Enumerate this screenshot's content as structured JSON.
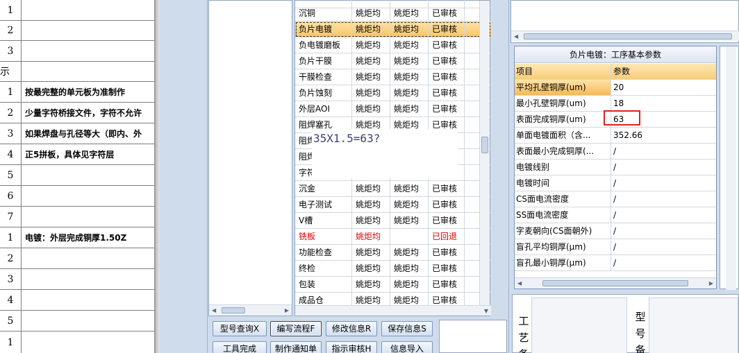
{
  "sheet": {
    "rows": [
      {
        "no": "1",
        "text": ""
      },
      {
        "no": "2",
        "text": ""
      },
      {
        "no": "3",
        "text": ""
      },
      {
        "no": "示",
        "text": ""
      },
      {
        "no": "1",
        "text": "按最完整的单元板为准制作"
      },
      {
        "no": "2",
        "text": "少量字符桥接文件，字符不允许"
      },
      {
        "no": "3",
        "text": "如果焊盘与孔径等大（即内、外"
      },
      {
        "no": "4",
        "text": "正5拼板，具体见字符层"
      },
      {
        "no": "5",
        "text": ""
      },
      {
        "no": "6",
        "text": ""
      },
      {
        "no": "7",
        "text": ""
      },
      {
        "no": "1",
        "text": "电镀：外层完成铜厚1.50Z"
      },
      {
        "no": "2",
        "text": ""
      },
      {
        "no": "3",
        "text": ""
      },
      {
        "no": "4",
        "text": ""
      },
      {
        "no": "5",
        "text": ""
      },
      {
        "no": "1",
        "text": ""
      }
    ]
  },
  "process": {
    "rows": [
      {
        "step": "",
        "a": "",
        "b": "",
        "status": ""
      },
      {
        "step": "沉铜",
        "a": "姚炬均",
        "b": "姚炬均",
        "status": "已审核"
      },
      {
        "step": "负片电镀",
        "a": "姚炬均",
        "b": "姚炬均",
        "status": "已审核",
        "selected": true
      },
      {
        "step": "负电镀磨板",
        "a": "姚炬均",
        "b": "姚炬均",
        "status": "已审核"
      },
      {
        "step": "负片干膜",
        "a": "姚炬均",
        "b": "姚炬均",
        "status": "已审核"
      },
      {
        "step": "干膜检查",
        "a": "姚炬均",
        "b": "姚炬均",
        "status": "已审核"
      },
      {
        "step": "负片蚀刻",
        "a": "姚炬均",
        "b": "姚炬均",
        "status": "已审核"
      },
      {
        "step": "外层AOI",
        "a": "姚炬均",
        "b": "姚炬均",
        "status": "已审核"
      },
      {
        "step": "阻焊塞孔",
        "a": "姚炬均",
        "b": "姚炬均",
        "status": "已审核"
      },
      {
        "step": "阻焊",
        "a": "",
        "b": "",
        "status": ""
      },
      {
        "step": "阻焊",
        "a": "",
        "b": "",
        "status": ""
      },
      {
        "step": "字符",
        "a": "",
        "b": "",
        "status": ""
      },
      {
        "step": "沉金",
        "a": "姚炬均",
        "b": "姚炬均",
        "status": "已审核"
      },
      {
        "step": "电子测试",
        "a": "姚炬均",
        "b": "姚炬均",
        "status": "已审核"
      },
      {
        "step": "V槽",
        "a": "姚炬均",
        "b": "姚炬均",
        "status": "已审核"
      },
      {
        "step": "铣板",
        "a": "姚炬均",
        "b": "",
        "status": "已回退",
        "rejected": true
      },
      {
        "step": "功能检查",
        "a": "姚炬均",
        "b": "姚炬均",
        "status": "已审核"
      },
      {
        "step": "终检",
        "a": "姚炬均",
        "b": "姚炬均",
        "status": "已审核"
      },
      {
        "step": "包装",
        "a": "姚炬均",
        "b": "姚炬均",
        "status": "已审核"
      },
      {
        "step": "成品仓",
        "a": "姚炬均",
        "b": "姚炬均",
        "status": "已审核"
      }
    ]
  },
  "note": {
    "text": "35X1.5=63?"
  },
  "buttons": {
    "row1": [
      "型号查询X",
      "编写流程F",
      "修改信息R",
      "保存信息S"
    ],
    "row2": [
      "工具完成",
      "制作通知单",
      "指示审核H",
      "信息导入"
    ]
  },
  "params": {
    "title": "负片电镀：工序基本参数",
    "col_item": "项目",
    "col_value": "参数",
    "rows": [
      {
        "item": "平均孔壁铜厚(um)",
        "value": "20"
      },
      {
        "item": "最小孔壁铜厚(um)",
        "value": "18"
      },
      {
        "item": "表面完成铜厚(um)",
        "value": "63"
      },
      {
        "item": "单面电镀面积（含...",
        "value": "352.66"
      },
      {
        "item": "表面最小完成铜厚(...",
        "value": "/"
      },
      {
        "item": "电镀线别",
        "value": "/"
      },
      {
        "item": "电镀时间",
        "value": "/"
      },
      {
        "item": "CS面电流密度",
        "value": "/"
      },
      {
        "item": "SS面电流密度",
        "value": "/"
      },
      {
        "item": "字麦朝向(CS面朝外)",
        "value": "/"
      },
      {
        "item": "盲孔平均铜厚(μm)",
        "value": "/"
      },
      {
        "item": "盲孔最小铜厚(μm)",
        "value": "/"
      }
    ]
  },
  "bottom": {
    "label1": [
      "工",
      "艺",
      "备"
    ],
    "label2": [
      "型",
      "号",
      "备"
    ]
  }
}
